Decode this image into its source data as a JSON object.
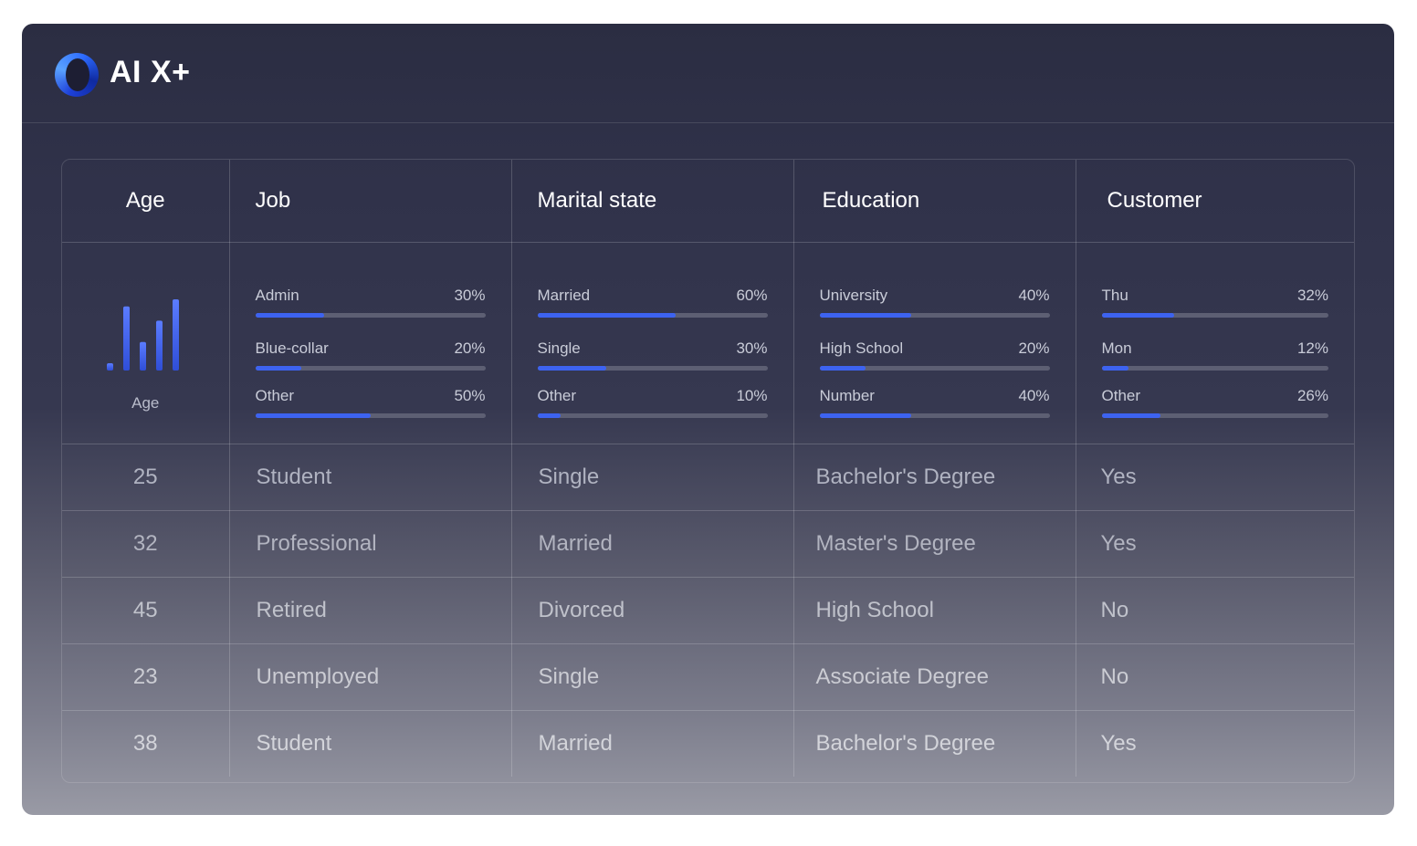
{
  "app": {
    "name": "AI X+"
  },
  "colors": {
    "accent": "#3d63f0",
    "track": "#5d5f73",
    "header_bg": "#2b2d42"
  },
  "columns": [
    "Age",
    "Job",
    "Marital state",
    "Education",
    "Customer"
  ],
  "summary": {
    "age": {
      "label": "Age",
      "chart_data": {
        "type": "bar",
        "values": [
          1,
          9,
          4,
          7,
          10
        ]
      }
    },
    "job": [
      {
        "label": "Admin",
        "value": "30%",
        "fill": 0.3
      },
      {
        "label": "Blue-collar",
        "value": "20%",
        "fill": 0.2
      },
      {
        "label": "Other",
        "value": "50%",
        "fill": 0.5
      }
    ],
    "marital": [
      {
        "label": "Married",
        "value": "60%",
        "fill": 0.6
      },
      {
        "label": "Single",
        "value": "30%",
        "fill": 0.3
      },
      {
        "label": "Other",
        "value": "10%",
        "fill": 0.1
      }
    ],
    "education": [
      {
        "label": "University",
        "value": "40%",
        "fill": 0.4
      },
      {
        "label": "High School",
        "value": "20%",
        "fill": 0.2
      },
      {
        "label": "Number",
        "value": "40%",
        "fill": 0.4
      }
    ],
    "customer": [
      {
        "label": "Thu",
        "value": "32%",
        "fill": 0.32
      },
      {
        "label": "Mon",
        "value": "12%",
        "fill": 0.12
      },
      {
        "label": "Other",
        "value": "26%",
        "fill": 0.26
      }
    ]
  },
  "rows": [
    {
      "age": "25",
      "job": "Student",
      "marital": "Single",
      "education": "Bachelor's Degree",
      "customer": "Yes"
    },
    {
      "age": "32",
      "job": "Professional",
      "marital": "Married",
      "education": "Master's Degree",
      "customer": "Yes"
    },
    {
      "age": "45",
      "job": "Retired",
      "marital": "Divorced",
      "education": "High School",
      "customer": "No"
    },
    {
      "age": "23",
      "job": "Unemployed",
      "marital": "Single",
      "education": "Associate Degree",
      "customer": "No"
    },
    {
      "age": "38",
      "job": "Student",
      "marital": "Married",
      "education": "Bachelor's Degree",
      "customer": "Yes"
    }
  ]
}
